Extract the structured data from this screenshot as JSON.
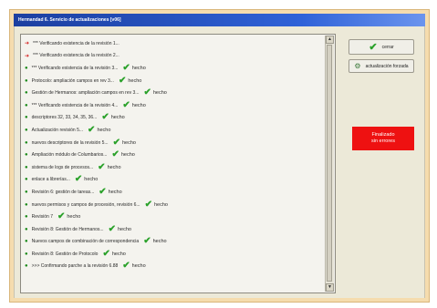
{
  "window": {
    "title": "Hermandad 6. Servicio de actualizaciones [v06]"
  },
  "log": [
    {
      "text": "*** Verificando existencia de la revisión 1...",
      "bullet": "red",
      "done": ""
    },
    {
      "text": "*** Verificando existencia de la revisión 2...",
      "bullet": "red",
      "done": ""
    },
    {
      "text": "*** Verificando existencia de la revisión 3...",
      "bullet": "green",
      "done": "hecho"
    },
    {
      "text": "Protocolo: ampliación campos en rev 3...",
      "bullet": "green",
      "done": "hecho"
    },
    {
      "text": "Gestión de Hermanos: ampliación campos en rev 3...",
      "bullet": "green",
      "done": "hecho"
    },
    {
      "text": "*** Verificando existencia de la revisión 4...",
      "bullet": "green",
      "done": "hecho"
    },
    {
      "text": "descriptores 32, 33, 34, 35, 36...",
      "bullet": "green",
      "done": "hecho"
    },
    {
      "text": "Actualización revisión 5...",
      "bullet": "green",
      "done": "hecho"
    },
    {
      "text": "nuevos descriptores de la revisión 5...",
      "bullet": "green",
      "done": "hecho"
    },
    {
      "text": "Ampliación módulo de Columbarios...",
      "bullet": "green",
      "done": "hecho"
    },
    {
      "text": "sistema de logs de procesos...",
      "bullet": "green",
      "done": "hecho"
    },
    {
      "text": "enlace a librerías...",
      "bullet": "green",
      "done": "hecho"
    },
    {
      "text": "Revisión 6: gestión de tareas...",
      "bullet": "green",
      "done": "hecho"
    },
    {
      "text": "nuevos permisos y campos de procesión, revisión 6...",
      "bullet": "green",
      "done": "hecho"
    },
    {
      "text": "Revisión 7",
      "bullet": "green",
      "done": "hecho"
    },
    {
      "text": "Revisión 8: Gestión de Hermanos...",
      "bullet": "green",
      "done": "hecho"
    },
    {
      "text": "Nuevos campos de combinación de correspondencia",
      "bullet": "green",
      "done": "hecho"
    },
    {
      "text": "Revisión 8: Gestión de Protocolo",
      "bullet": "green",
      "done": "hecho"
    },
    {
      "text": ">>> Confirmando parche a la revisión 6.88",
      "bullet": "green",
      "done": "hecho"
    }
  ],
  "buttons": {
    "close_label": "cerrar",
    "force_label": "actualización forzada"
  },
  "status": {
    "line1": "Finalizado",
    "line2": "sin errores",
    "color": "#ee1111"
  },
  "icons": {
    "red_bullet": "red-arrow-icon",
    "green_bullet": "green-dot-icon",
    "check": "check-icon",
    "force": "gear-icon"
  }
}
